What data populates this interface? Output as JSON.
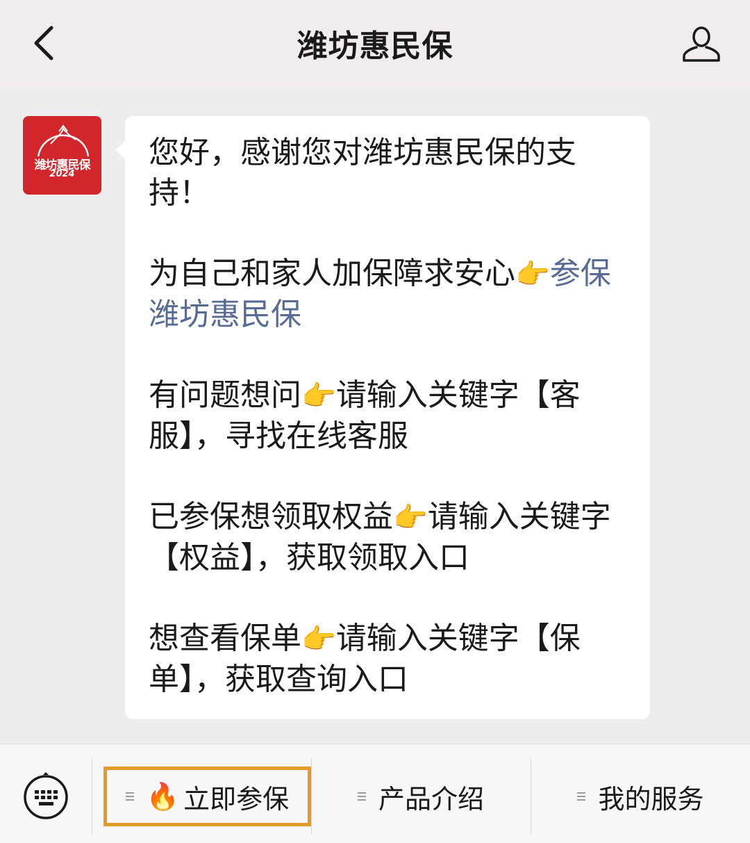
{
  "header": {
    "title": "潍坊惠民保"
  },
  "account": {
    "avatar_text": "潍坊惠民保",
    "avatar_year": "2024"
  },
  "message": {
    "p1": "您好，感谢您对潍坊惠民保的支持！",
    "p2_text": "为自己和家人加保障求安心",
    "p2_emoji": "👉",
    "p2_link": "参保潍坊惠民保",
    "p3_text": "有问题想问",
    "p3_emoji": "👉",
    "p3_rest": "请输入关键字【客服】，寻找在线客服",
    "p4_text": "已参保想领取权益",
    "p4_emoji": "👉",
    "p4_rest": "请输入关键字【权益】，获取领取入口",
    "p5_text": "想查看保单",
    "p5_emoji": "👉",
    "p5_rest": "请输入关键字【保单】，获取查询入口"
  },
  "menu": {
    "item1_emoji": "🔥",
    "item1_label": "立即参保",
    "item2_label": "产品介绍",
    "item3_label": "我的服务"
  },
  "colors": {
    "link": "#576b95",
    "highlight_border": "#e69a28",
    "brand_red": "#d1262b"
  }
}
